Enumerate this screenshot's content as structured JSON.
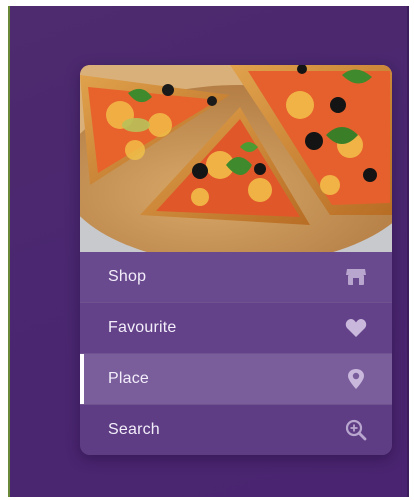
{
  "photo": {
    "subject": "pizza-image"
  },
  "menu": {
    "items": [
      {
        "label": "Shop",
        "icon": "shop-icon",
        "active": false
      },
      {
        "label": "Favourite",
        "icon": "heart-icon",
        "active": false
      },
      {
        "label": "Place",
        "icon": "location-pin-icon",
        "active": true
      },
      {
        "label": "Search",
        "icon": "zoom-in-icon",
        "active": false
      }
    ]
  },
  "colors": {
    "background": "#4a2770",
    "menu_item": "#6a4a8f",
    "menu_item_active": "#7a5d9b",
    "text": "#f3eefa",
    "active_indicator": "#ffffff"
  }
}
